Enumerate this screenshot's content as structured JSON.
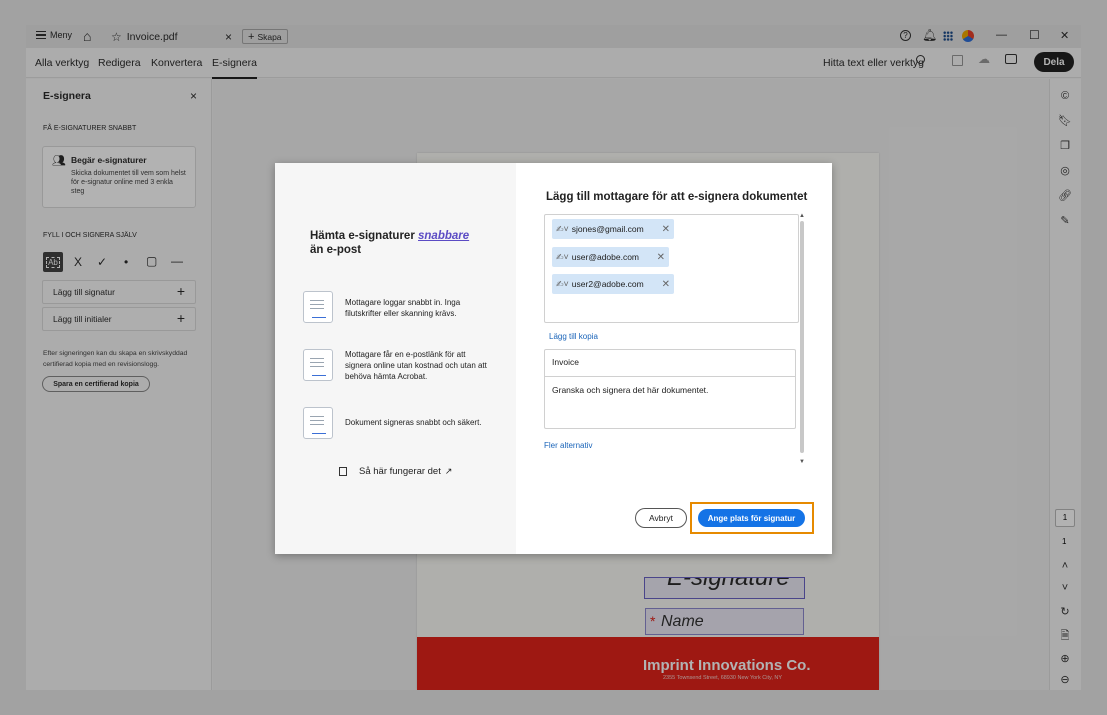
{
  "titlebar": {
    "menu_label": "Meny",
    "tab_title": "Invoice.pdf",
    "close_tab": "×",
    "create_label": "Skapa",
    "window_min": "—",
    "window_max": "☐",
    "window_close": "✕"
  },
  "menubar": {
    "tabs": [
      "Alla verktyg",
      "Redigera",
      "Konvertera",
      "E-signera"
    ],
    "active_tab": "E-signera",
    "search_label": "Hitta text eller verktyg",
    "share_label": "Dela"
  },
  "left_panel": {
    "title": "E-signera",
    "close": "×",
    "section1_header": "FÅ E-SIGNATURER SNABBT",
    "request_title": "Begär e-signaturer",
    "request_desc": "Skicka dokumentet till vem som helst för e-signatur online med 3 enkla steg",
    "section2_header": "FYLL I OCH SIGNERA SJÄLV",
    "tools": [
      "X",
      "✓",
      "•",
      "▢",
      "—"
    ],
    "text_tool": "Ab",
    "add_signature": "Lägg till signatur",
    "add_initials": "Lägg till initialer",
    "plus": "+",
    "certify_note": "Efter signeringen kan du skapa en skrivskyddad certifierad kopia med en revisionslogg.",
    "certify_button": "Spara en certifierad kopia"
  },
  "document": {
    "signature_field": "E-signature",
    "name_field": "Name",
    "required_marker": "*",
    "company": "Imprint Innovations Co.",
    "address": "2355 Townsend Street, 68930 New York City, NY"
  },
  "dialog": {
    "left": {
      "title_part1": "Hämta e-signaturer",
      "title_link": "snabbare",
      "title_part2": "än e-post",
      "features": [
        "Mottagare loggar snabbt in. Inga filutskrifter eller skanning krävs.",
        "Mottagare får en e-postlänk för att signera online utan kostnad och utan att behöva hämta Acrobat.",
        "Dokument signeras snabbt och säkert."
      ],
      "how_it_works": "Så här fungerar det"
    },
    "right": {
      "title": "Lägg till mottagare för att e-signera dokumentet",
      "recipients": [
        "sjones@gmail.com",
        "user@adobe.com",
        "user2@adobe.com"
      ],
      "add_copy": "Lägg till kopia",
      "subject": "Invoice",
      "message": "Granska och signera det här dokumentet.",
      "more_options": "Fler alternativ",
      "cancel": "Avbryt",
      "primary": "Ange plats för signatur"
    }
  },
  "right_rail": {
    "page_current": "1",
    "page_total": "1"
  },
  "colors": {
    "accent_blue": "#1473e6",
    "highlight_orange": "#e68a00",
    "chip_bg": "#d3e5f7",
    "footer_red": "#e2231a"
  }
}
